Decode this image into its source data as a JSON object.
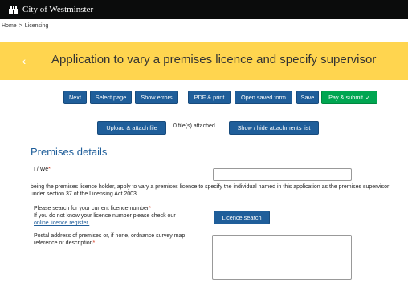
{
  "header": {
    "brand": "City of Westminster"
  },
  "breadcrumb": {
    "home": "Home",
    "separator": ">",
    "current": "Licensing"
  },
  "banner": {
    "back": "‹",
    "title": "Application to vary a premises licence and specify supervisor"
  },
  "toolbar": {
    "next": "Next",
    "select_page": "Select page",
    "show_errors": "Show errors",
    "pdf_print": "PDF & print",
    "open_saved": "Open saved form",
    "save": "Save",
    "pay_submit": "Pay & submit",
    "pay_check": "✓"
  },
  "attachments": {
    "upload": "Upload & attach file",
    "count": "0 file(s) attached",
    "toggle": "Show / hide attachments list"
  },
  "section": {
    "title": "Premises details"
  },
  "form": {
    "i_we_label": "I / We",
    "required_mark": "*",
    "statement": "being the premises licence holder, apply to vary a premises licence to specify the individual named in this application as the premises supervisor under section 37 of the Licensing Act 2003.",
    "licence_search_label": "Please search for your current licence number",
    "licence_help": "If you do not know your licence number please check our",
    "register_link": "online licence register.",
    "licence_search_button": "Licence search",
    "postal_label": "Postal address of premises or, if none, ordnance survey map reference or description"
  },
  "colors": {
    "banner": "#ffd54f",
    "button": "#1f5e9a",
    "submit": "#00a651",
    "topbar": "#0b0c0c"
  }
}
